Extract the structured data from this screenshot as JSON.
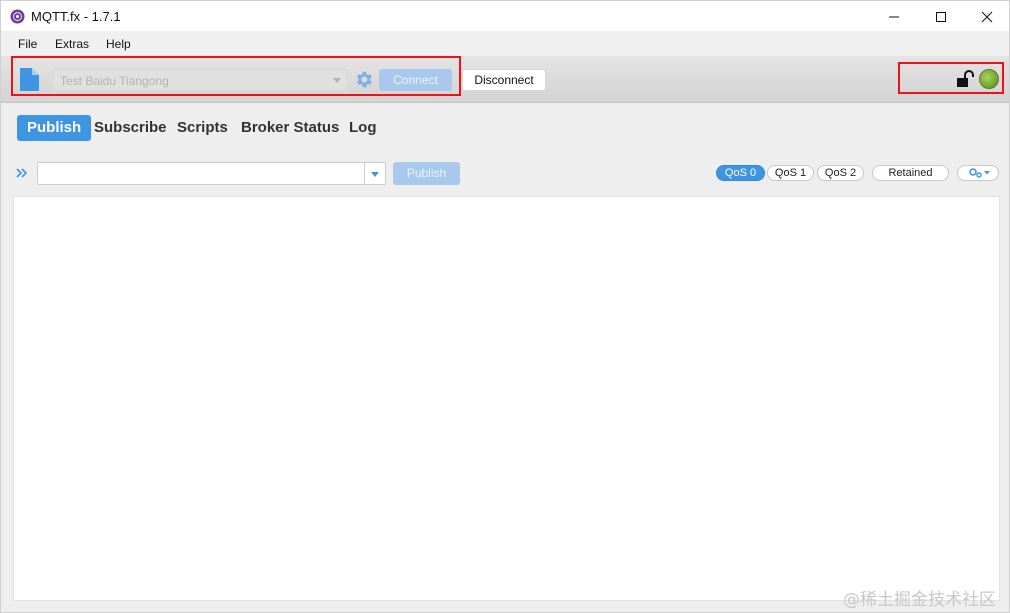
{
  "window": {
    "title": "MQTT.fx - 1.7.1",
    "icon": "mqttfx-app-icon",
    "controls": [
      "minimize-icon",
      "maximize-icon",
      "close-icon"
    ]
  },
  "menu": {
    "items": [
      "File",
      "Extras",
      "Help"
    ]
  },
  "toolbar": {
    "file_icon": "file-icon",
    "profile_value": "Test Baidu Tiangong",
    "gear_icon": "gear-icon",
    "connect_label": "Connect",
    "disconnect_label": "Disconnect",
    "lock_icon": "unlock-icon",
    "status_color": "#7fb237",
    "highlight_color": "#e8141c"
  },
  "tabs": [
    {
      "label": "Publish",
      "active": true
    },
    {
      "label": "Subscribe",
      "active": false
    },
    {
      "label": "Scripts",
      "active": false
    },
    {
      "label": "Broker Status",
      "active": false
    },
    {
      "label": "Log",
      "active": false
    }
  ],
  "publish": {
    "expand_icon": "double-chevron-right-icon",
    "topic_value": "",
    "publish_label": "Publish",
    "qos": [
      "QoS 0",
      "QoS 1",
      "QoS 2"
    ],
    "qos_selected": "QoS 0",
    "retained_label": "Retained",
    "settings_icon": "gears-dropdown-icon"
  },
  "accent_color": "#3e95e2",
  "watermark": "@稀土掘金技术社区"
}
